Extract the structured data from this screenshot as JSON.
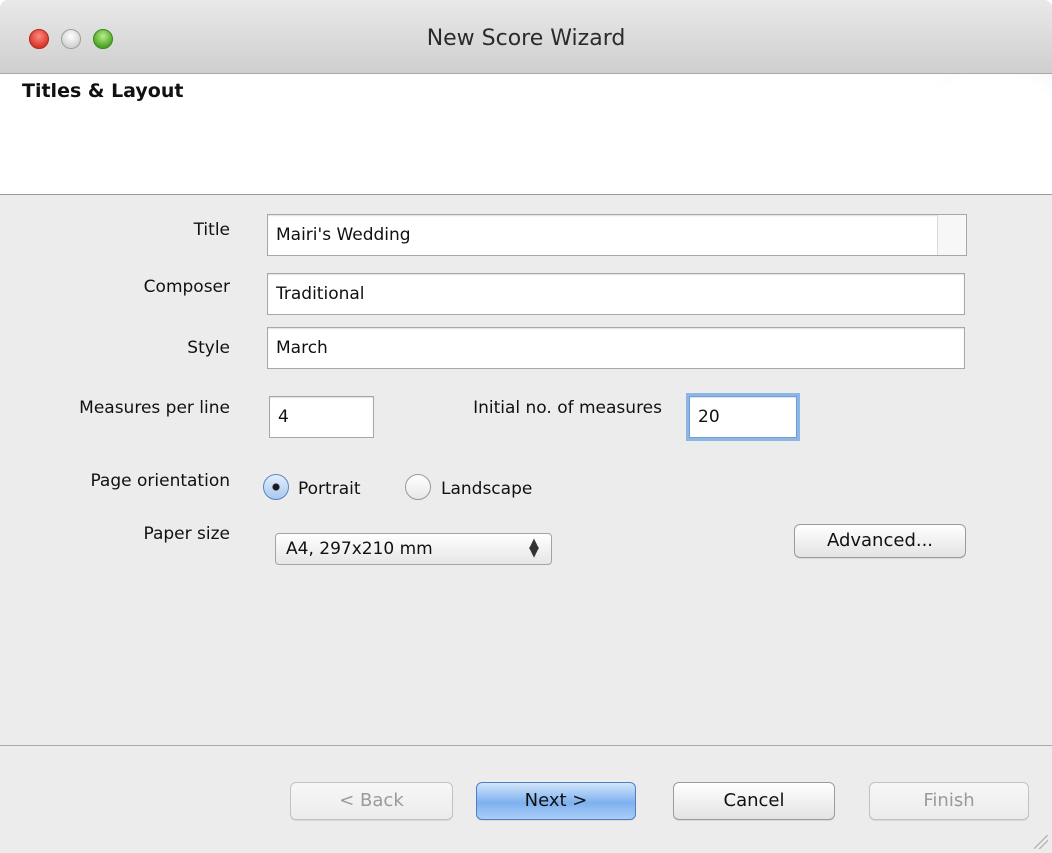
{
  "window": {
    "title": "New Score Wizard"
  },
  "header": {
    "title": "Titles & Layout"
  },
  "form": {
    "title_label": "Title",
    "title_value": "Mairi's Wedding",
    "composer_label": "Composer",
    "composer_value": "Traditional",
    "style_label": "Style",
    "style_value": "March",
    "measures_per_line_label": "Measures per line",
    "measures_per_line_value": "4",
    "initial_measures_label": "Initial no. of measures",
    "initial_measures_value": "20",
    "page_orientation_label": "Page orientation",
    "portrait_label": "Portrait",
    "landscape_label": "Landscape",
    "orientation_selected": "Portrait",
    "paper_size_label": "Paper size",
    "paper_size_value": "A4, 297x210 mm",
    "advanced_label": "Advanced..."
  },
  "footer": {
    "back_label": "< Back",
    "next_label": "Next >",
    "cancel_label": "Cancel",
    "finish_label": "Finish"
  },
  "colors": {
    "accent": "#7fb1ef",
    "focus_ring": "#8db6e6",
    "close_light": "#d9372c",
    "zoom_light": "#4fa428"
  },
  "icons": [
    "close-light-icon",
    "minimize-light-icon",
    "zoom-light-icon",
    "select-arrows-icon",
    "resize-grip-icon"
  ]
}
